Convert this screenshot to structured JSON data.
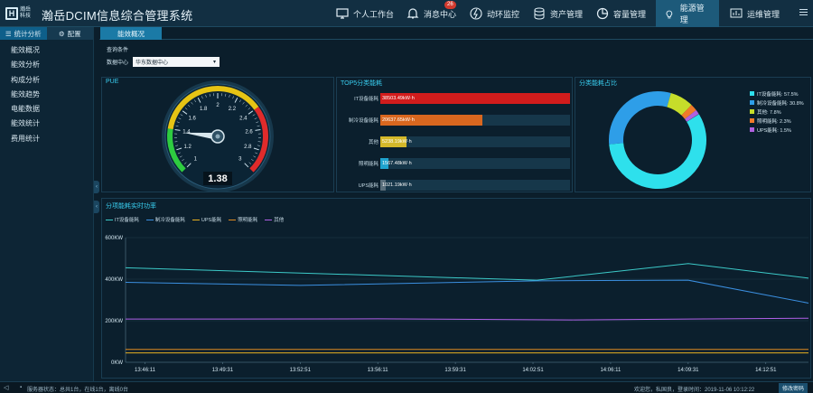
{
  "app": {
    "logo_text_1": "瀚岳",
    "logo_text_2": "科技",
    "title": "瀚岳DCIM信息综合管理系统"
  },
  "nav": [
    {
      "label": "个人工作台",
      "icon": "monitor-icon"
    },
    {
      "label": "消息中心",
      "icon": "bell-icon",
      "badge": "26"
    },
    {
      "label": "动环监控",
      "icon": "lightning-icon"
    },
    {
      "label": "资产管理",
      "icon": "database-icon"
    },
    {
      "label": "容量管理",
      "icon": "pie-icon"
    },
    {
      "label": "能源管理",
      "icon": "bulb-icon",
      "active": true
    },
    {
      "label": "运维管理",
      "icon": "chart-monitor-icon"
    }
  ],
  "sidebar": {
    "tabs": [
      "统计分析",
      "配置"
    ],
    "items": [
      "能效概况",
      "能效分析",
      "构成分析",
      "能效趋势",
      "电能数据",
      "能效统计",
      "费用统计"
    ]
  },
  "content_tab": "能效概况",
  "filter": {
    "section_label": "查询条件",
    "field_label": "数据中心",
    "value": "华东数据中心"
  },
  "pue": {
    "title": "PUE",
    "value": "1.38",
    "value_num": 1.38,
    "ticks": [
      "1",
      "1.2",
      "1.4",
      "1.6",
      "1.8",
      "2",
      "2.2",
      "2.4",
      "2.6",
      "2.8",
      "3"
    ],
    "colors": {
      "good": "#2ecc40",
      "mid": "#e6c414",
      "bad": "#e02b2b"
    }
  },
  "top5": {
    "title": "TOP5分类能耗",
    "items": [
      {
        "label": "IT设备能耗",
        "value": "38503.49kW·h",
        "num": 38503.49,
        "color": "#d11c1c"
      },
      {
        "label": "制冷设备能耗",
        "value": "20637.65kW·h",
        "num": 20637.65,
        "color": "#d9671f"
      },
      {
        "label": "其他",
        "value": "5238.19kW·h",
        "num": 5238.19,
        "color": "#d4b82a"
      },
      {
        "label": "照明能耗",
        "value": "1567.48kW·h",
        "num": 1567.48,
        "color": "#1fa3cf"
      },
      {
        "label": "UPS能耗",
        "value": "1021.19kW·h",
        "num": 1021.19,
        "color": "#5a6f7c"
      }
    ]
  },
  "ratio": {
    "title": "分类能耗占比",
    "items": [
      {
        "label": "IT设备能耗: 57.5%",
        "pct": 57.5,
        "color": "#2ee0ec"
      },
      {
        "label": "制冷设备能耗: 30.8%",
        "pct": 30.8,
        "color": "#2e9ee8"
      },
      {
        "label": "其他: 7.8%",
        "pct": 7.8,
        "color": "#c6dd2a"
      },
      {
        "label": "照明能耗: 2.3%",
        "pct": 2.3,
        "color": "#f07a2a"
      },
      {
        "label": "UPS能耗: 1.5%",
        "pct": 1.5,
        "color": "#b061e0"
      }
    ]
  },
  "power": {
    "title": "分项能耗实时功率",
    "legend": [
      {
        "label": "IT设备能耗",
        "color": "#3ccac8"
      },
      {
        "label": "制冷设备能耗",
        "color": "#3b8fe0"
      },
      {
        "label": "UPS能耗",
        "color": "#e8b020"
      },
      {
        "label": "照明能耗",
        "color": "#e08a20"
      },
      {
        "label": "其他",
        "color": "#b060e8"
      }
    ]
  },
  "chart_data": {
    "type": "line",
    "title": "分项能耗实时功率",
    "x": [
      "13:46:11",
      "13:49:31",
      "13:52:51",
      "13:56:11",
      "13:59:31",
      "14:02:51",
      "14:06:11",
      "14:09:31",
      "14:12:51"
    ],
    "y_ticks": [
      "0KW",
      "200KW",
      "400KW",
      "600KW"
    ],
    "ylim": [
      0,
      600
    ],
    "series": [
      {
        "name": "IT设备能耗",
        "color": "#3ccac8",
        "points": [
          [
            0,
            455
          ],
          [
            5.05,
            395
          ],
          [
            7,
            475
          ],
          [
            8,
            405
          ]
        ]
      },
      {
        "name": "制冷设备能耗",
        "color": "#3b8fe0",
        "points": [
          [
            0,
            385
          ],
          [
            2,
            370
          ],
          [
            5.05,
            392
          ],
          [
            7,
            395
          ],
          [
            8,
            285
          ]
        ]
      },
      {
        "name": "其他",
        "color": "#b060e8",
        "points": [
          [
            0,
            208
          ],
          [
            3,
            209
          ],
          [
            5.5,
            204
          ],
          [
            8,
            212
          ]
        ]
      },
      {
        "name": "照明能耗",
        "color": "#e08a20",
        "points": [
          [
            0,
            62
          ],
          [
            8,
            62
          ]
        ]
      },
      {
        "name": "UPS能耗",
        "color": "#e8b020",
        "points": [
          [
            0,
            45
          ],
          [
            8,
            45
          ]
        ]
      }
    ]
  },
  "status": {
    "left": "服务器状态：总共1台，在线1台，离线0台",
    "user": "欢迎您，私国良，登录时间：2019-11-06 10:12:22",
    "button": "修改密码"
  }
}
